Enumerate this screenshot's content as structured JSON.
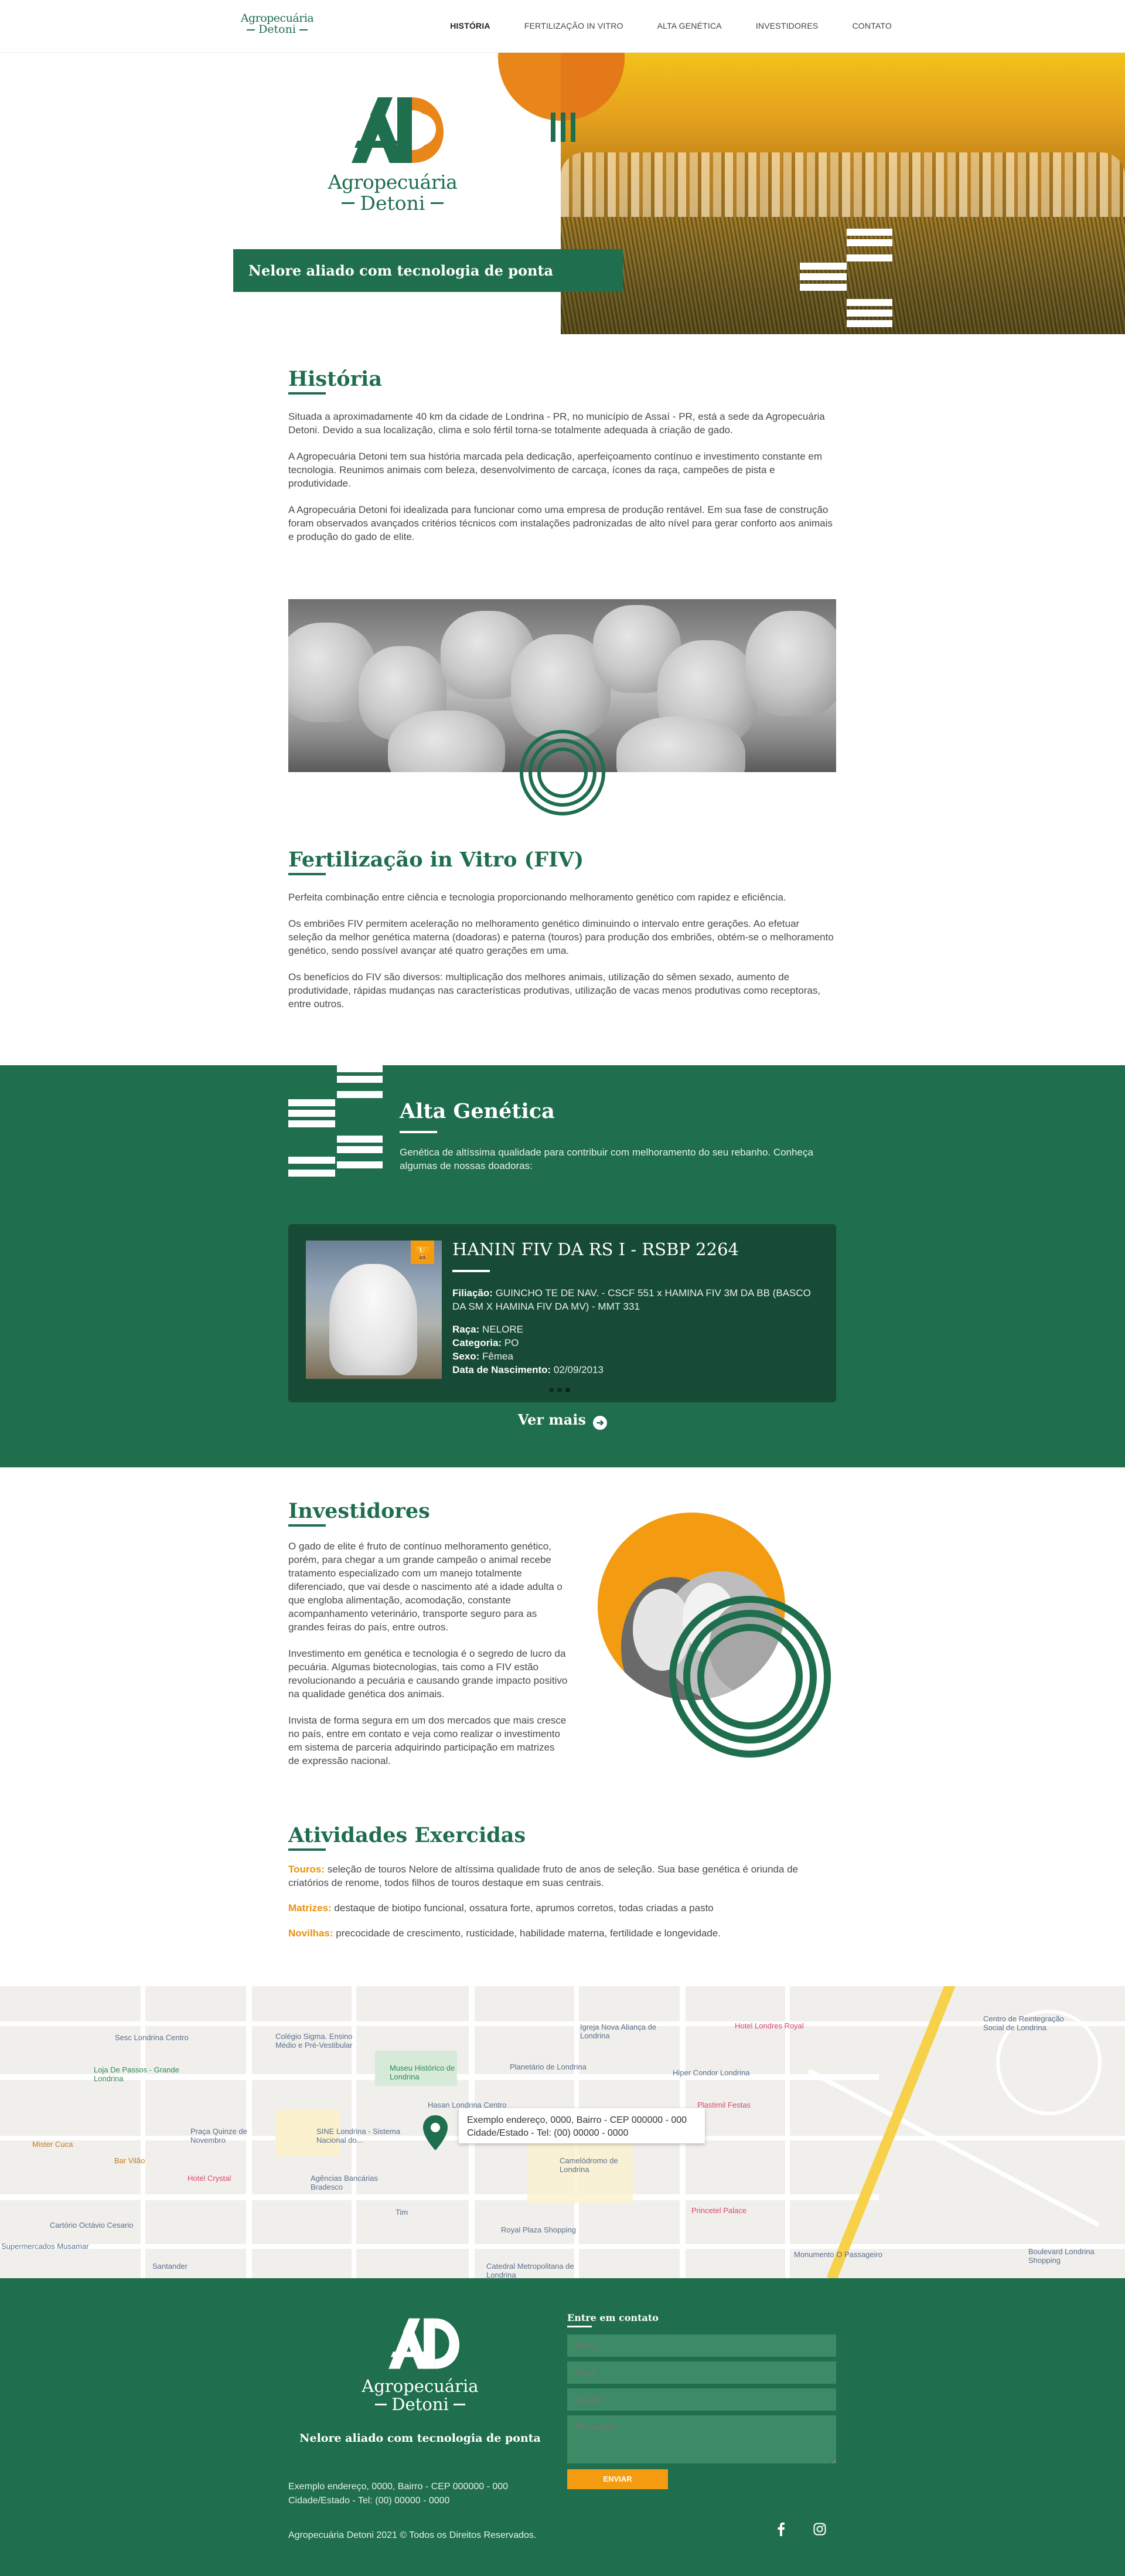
{
  "header": {
    "logo_line1": "Agropecuária",
    "logo_line2": "Detoni",
    "nav": [
      {
        "label": "História"
      },
      {
        "label": "Fertilização in Vitro"
      },
      {
        "label": "Alta Genética"
      },
      {
        "label": "Investidores"
      },
      {
        "label": "Contato"
      }
    ]
  },
  "hero": {
    "logo_line1": "Agropecuária",
    "logo_line2": "Detoni",
    "tagline": "Nelore aliado com tecnologia de ponta"
  },
  "historia": {
    "title": "História",
    "paragraphs": [
      "Situada a aproximadamente 40 km da cidade de Londrina - PR, no município de Assaí - PR, está a sede da Agropecuária Detoni. Devido a sua localização, clima e solo fértil torna-se totalmente adequada à criação de gado.",
      "A Agropecuária Detoni tem sua história marcada pela dedicação, aperfeiçoamento contínuo e investimento constante em tecnologia. Reunimos animais com beleza, desenvolvimento de carcaça, ícones da raça, campeões de pista e produtividade.",
      "A Agropecuária Detoni foi idealizada para funcionar como uma empresa de produção rentável. Em sua fase de construção foram observados avançados critérios técnicos com instalações padronizadas de alto nível para gerar conforto aos animais e produção do gado de elite."
    ]
  },
  "fiv": {
    "title": "Fertilização in Vitro (FIV)",
    "paragraphs": [
      "Perfeita combinação entre ciência e tecnologia proporcionando melhoramento genético com rapidez e eficiência.",
      "Os embriões FIV permitem aceleração no melhoramento genético diminuindo o intervalo entre gerações. Ao efetuar seleção da melhor genética materna (doadoras) e paterna (touros) para produção dos embriões, obtém-se o melhoramento genético, sendo possível avançar até quatro gerações em uma.",
      "Os benefícios do FIV são diversos: multiplicação dos melhores animais, utilização do sêmen sexado, aumento de produtividade, rápidas mudanças nas características produtivas, utilização de vacas menos produtivas como receptoras, entre outros."
    ]
  },
  "alta": {
    "title": "Alta Genética",
    "description": "Genética de altíssima qualidade para contribuir com melhoramento do seu rebanho. Conheça algumas de nossas doadoras:",
    "card": {
      "name": "HANIN FIV DA RS I - RSBP 2264",
      "filiacao_label": "Filiação:",
      "filiacao": "GUINCHO TE DE NAV. - CSCF 551 x HAMINA FIV 3M DA BB (BASCO DA SM X HAMINA FIV DA MV) - MMT 331",
      "raca_label": "Raça:",
      "raca": "NELORE",
      "categoria_label": "Categoria:",
      "categoria": "PO",
      "sexo_label": "Sexo:",
      "sexo": "Fêmea",
      "nascimento_label": "Data de Nascimento:",
      "nascimento": "02/09/2013",
      "trophy_icon": "trophy-icon",
      "slides": 3,
      "active_slide": 3
    },
    "ver_mais": "Ver mais"
  },
  "investidores": {
    "title": "Investidores",
    "paragraphs": [
      "O gado de elite é fruto de contínuo melhoramento genético, porém, para chegar a um grande campeão o animal recebe tratamento especializado com um manejo totalmente diferenciado, que vai desde o nascimento até a idade adulta o que engloba alimentação, acomodação, constante acompanhamento veterinário, transporte seguro para as grandes feiras do país, entre outros.",
      "Investimento em genética e tecnologia é o segredo de lucro da pecuária. Algumas biotecnologias, tais como a FIV estão revolucionando a pecuária e causando grande impacto positivo na qualidade genética dos animais.",
      "Invista de forma segura em um dos mercados que mais cresce no país, entre em contato e veja como realizar o investimento em sistema de parceria adquirindo participação em matrizes de expressão nacional."
    ]
  },
  "atividades": {
    "title": "Atividades Exercidas",
    "items": [
      {
        "label": "Touros:",
        "text": "seleção de touros Nelore de altíssima qualidade fruto de anos de seleção. Sua base genética é oriunda de criatórios de renome, todos filhos de touros destaque em suas centrais."
      },
      {
        "label": "Matrizes:",
        "text": "destaque de biotipo funcional, ossatura forte, aprumos corretos, todas criadas a pasto"
      },
      {
        "label": "Novilhas:",
        "text": "precocidade de crescimento, rusticidade, habilidade materna, fertilidade e longevidade."
      }
    ]
  },
  "map": {
    "info_line1": "Exemplo endereço, 0000, Bairro - CEP 000000 - 000",
    "info_line2": "Cidade/Estado - Tel: (00) 00000 - 0000",
    "labels": {
      "sesc": "Sesc Londrina Centro",
      "colegio": "Colégio Sigma. Ensino Médio e Pré-Vestibular",
      "igreja": "Igreja Nova Aliança de Londrina",
      "hotel_royal": "Hotel Londres Royal",
      "centro_reint": "Centro de Reintegração Social de Londrina",
      "loja_passos": "Loja De Passos - Grande Londrina",
      "museu": "Museu Histórico de Londrina",
      "planetario": "Planetário de Londrina",
      "hiper": "Hiper Condor Londrina",
      "hasan": "Hasan Londrina Centro",
      "plastimil": "Plastimil Festas",
      "mister": "Mister Cuca",
      "bar": "Bar Vilão",
      "praca": "Praça Quinze de Novembro",
      "sine": "SINE Londrina - Sistema Nacional do...",
      "camelodromo": "Camelódromo de Londrina",
      "hotel_crystal": "Hotel Crystal",
      "agencias": "Agências Bancárias Bradesco",
      "cartorio": "Cartório Octávio Cesario",
      "tim": "Tim",
      "royal_plaza": "Royal Plaza Shopping",
      "pirineu": "Princetel Palace",
      "monumento": "Monumento O Passageiro",
      "boulevard": "Boulevard Londrina Shopping",
      "supermercados": "Supermercados Musamar",
      "santander": "Santander",
      "catedral": "Catedral Metropolitana de Londrina"
    }
  },
  "footer": {
    "logo_line1": "Agropecuária",
    "logo_line2": "Detoni",
    "tagline": "Nelore aliado com tecnologia de ponta",
    "address_line1": "Exemplo endereço, 0000, Bairro - CEP 000000 - 000",
    "address_line2": "Cidade/Estado - Tel: (00) 00000 - 0000",
    "copyright": "Agropecuária Detoni 2021 © Todos os Direitos Reservados.",
    "contact_title": "Entre em contato",
    "placeholders": {
      "nome": "Nome",
      "email": "Email",
      "assunto": "Assunto",
      "mensagem": "Mensagem"
    },
    "send_label": "ENVIAR",
    "social": [
      "facebook-icon",
      "instagram-icon"
    ]
  },
  "colors": {
    "brand_green": "#1f6e4e",
    "dark_green": "#174b35",
    "accent_orange": "#f39c12"
  }
}
